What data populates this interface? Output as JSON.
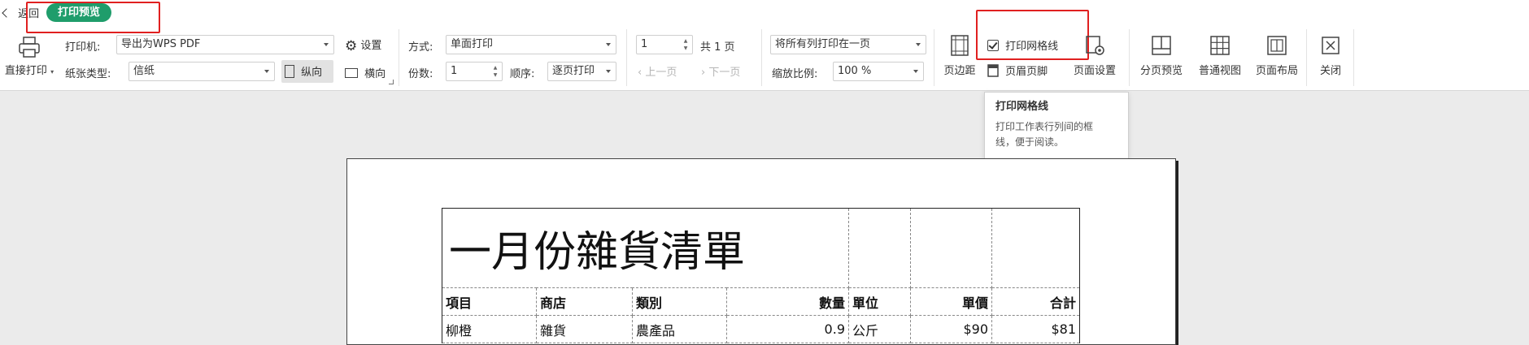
{
  "header": {
    "back_label": "返回",
    "mode_badge": "打印预览"
  },
  "printer": {
    "direct_print_label": "直接打印",
    "printer_label": "打印机:",
    "printer_value": "导出为WPS PDF",
    "settings_label": "设置",
    "paper_label": "纸张类型:",
    "paper_value": "信纸",
    "portrait_label": "纵向",
    "landscape_label": "横向"
  },
  "print_opts": {
    "mode_label": "方式:",
    "mode_value": "单面打印",
    "copies_label": "份数:",
    "copies_value": "1",
    "order_label": "顺序:",
    "order_value": "逐页打印"
  },
  "pager": {
    "page_value": "1",
    "total_label": "共 1 页",
    "prev_label": "上一页",
    "next_label": "下一页"
  },
  "scaling": {
    "fit_value": "将所有列打印在一页",
    "zoom_label": "缩放比例:",
    "zoom_value": "100 %"
  },
  "ribbon": {
    "margins": "页边距",
    "gridlines": "打印网格线",
    "header_footer": "页眉页脚",
    "page_setup": "页面设置",
    "page_break_preview": "分页预览",
    "normal_view": "普通视图",
    "page_layout": "页面布局",
    "close": "关闭"
  },
  "tooltip": {
    "title": "打印网格线",
    "body_line1": "打印工作表行列间的框",
    "body_line2": "线，便于阅读。"
  },
  "sheet": {
    "title": "一月份雜貨清單",
    "headers": [
      "項目",
      "商店",
      "類別",
      "數量",
      "單位",
      "單價",
      "合計"
    ],
    "rows": [
      [
        "柳橙",
        "雜貨",
        "農產品",
        "0.9",
        "公斤",
        "$90",
        "$81"
      ]
    ]
  },
  "colors": {
    "accent_green": "#1f9d6b",
    "highlight_red": "#e02020"
  }
}
